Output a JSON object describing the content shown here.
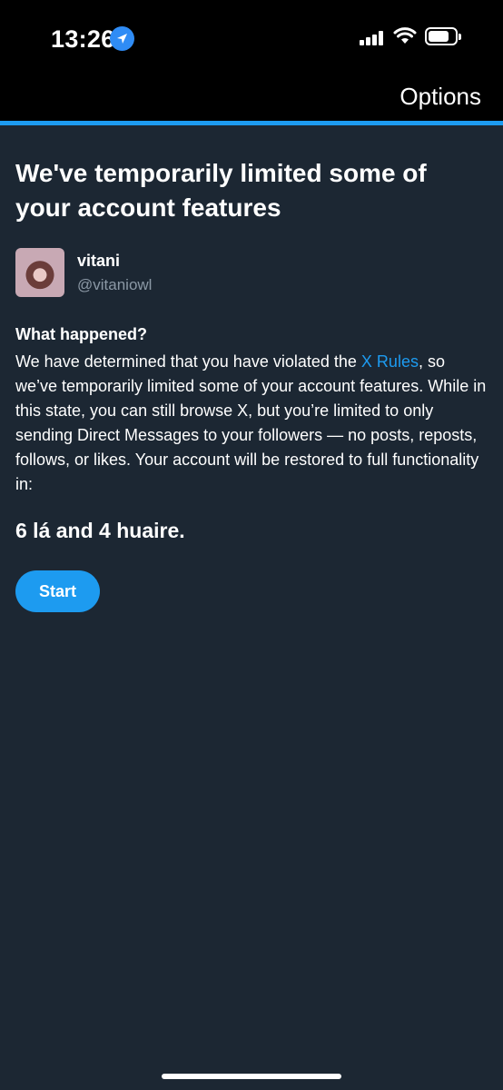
{
  "status_bar": {
    "time": "13:26",
    "icons": [
      "location-icon",
      "signal-icon",
      "wifi-icon",
      "battery-icon"
    ]
  },
  "header": {
    "options_label": "Options",
    "accent_color": "#1d9bf0"
  },
  "main": {
    "title": "We've temporarily limited some of your account features",
    "user": {
      "display_name": "vitani",
      "handle": "@vitaniowl"
    },
    "section_heading": "What happened?",
    "body_before_link": "We have determined that you have violated the ",
    "body_link": "X Rules",
    "body_after_link": ", so we’ve temporarily limited some of your account features. While in this state, you can still browse X, but you’re limited to only sending Direct Messages to your followers — no posts, reposts, follows, or likes. Your account will be restored to full functionality in:",
    "timer": "6 lá and 4 huaire.",
    "start_label": "Start"
  },
  "colors": {
    "background": "#1c2733",
    "topbar": "#000000",
    "secondary_text": "#8b98a5"
  }
}
